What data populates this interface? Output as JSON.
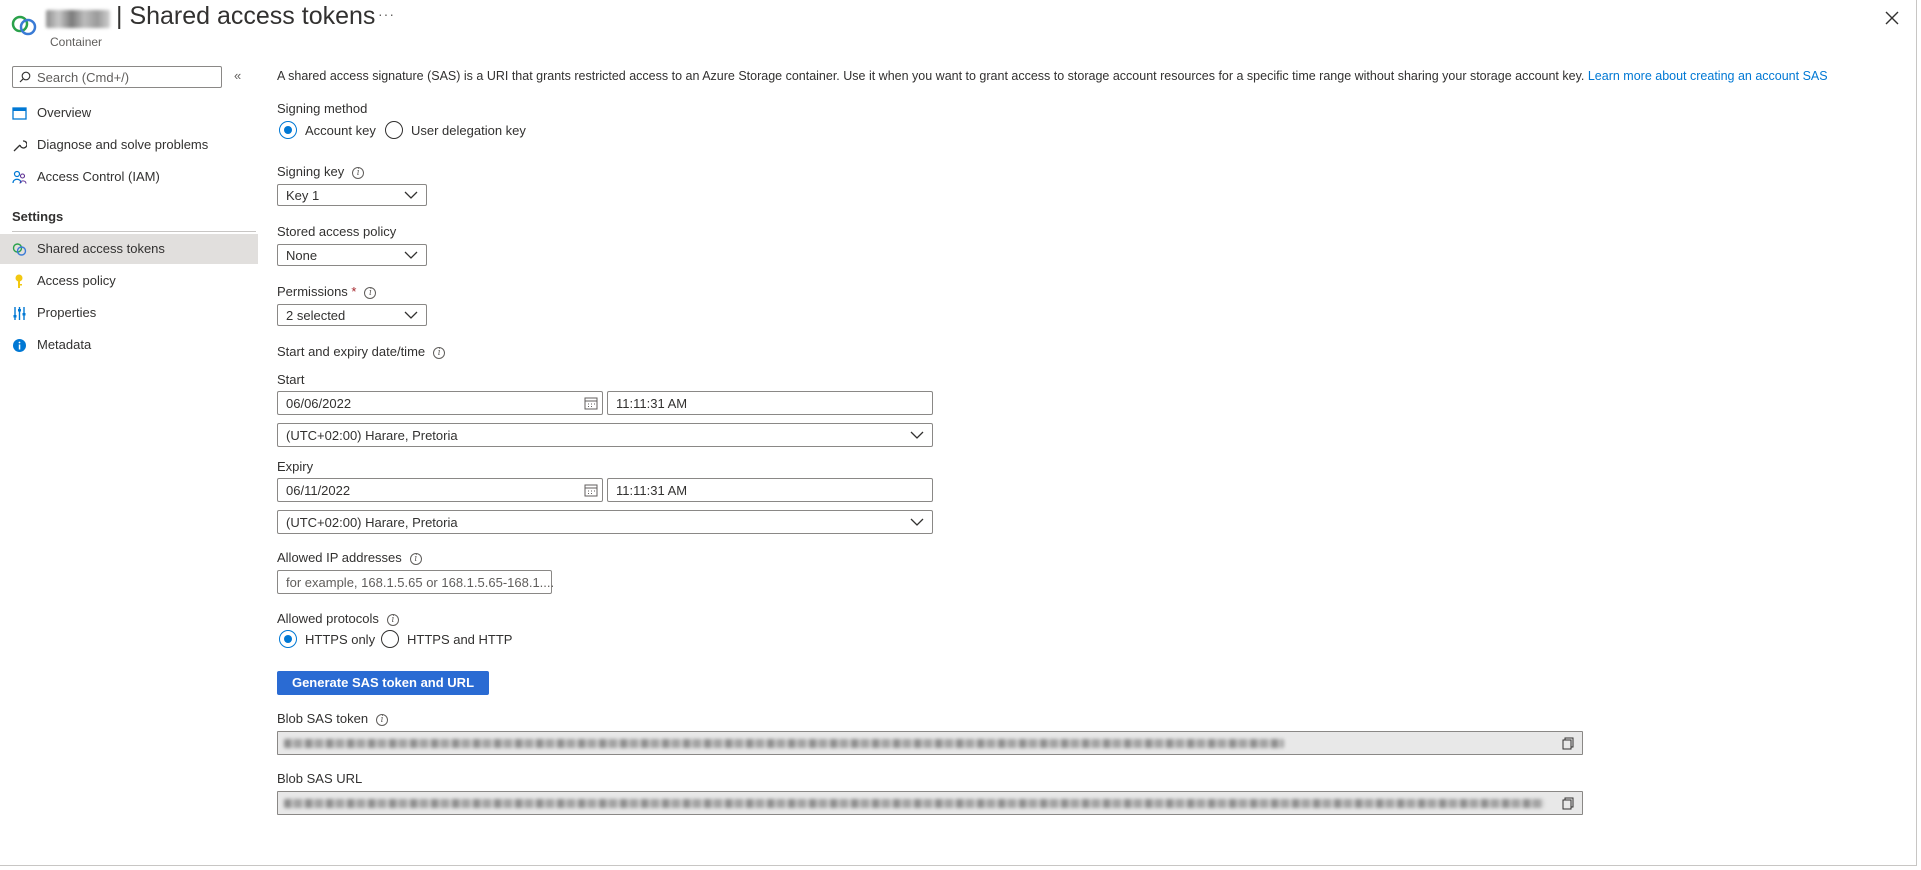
{
  "header": {
    "title": "| Shared access tokens",
    "subtitle": "Container",
    "more_label": "···",
    "close_icon": "close-icon"
  },
  "sidebar": {
    "search_placeholder": "Search (Cmd+/)",
    "collapse_label": "«",
    "items": [
      {
        "label": "Overview",
        "icon": "overview-icon"
      },
      {
        "label": "Diagnose and solve problems",
        "icon": "wrench-icon"
      },
      {
        "label": "Access Control (IAM)",
        "icon": "people-icon"
      }
    ],
    "settings_header": "Settings",
    "settings_items": [
      {
        "label": "Shared access tokens",
        "icon": "link-icon",
        "active": true
      },
      {
        "label": "Access policy",
        "icon": "key-icon"
      },
      {
        "label": "Properties",
        "icon": "sliders-icon"
      },
      {
        "label": "Metadata",
        "icon": "info-icon"
      }
    ]
  },
  "main": {
    "intro_text": "A shared access signature (SAS) is a URI that grants restricted access to an Azure Storage container. Use it when you want to grant access to storage account resources for a specific time range without sharing your storage account key.",
    "intro_link": "Learn more about creating an account SAS",
    "signing_method": {
      "label": "Signing method",
      "options": [
        "Account key",
        "User delegation key"
      ],
      "selected": "Account key"
    },
    "signing_key": {
      "label": "Signing key",
      "value": "Key 1"
    },
    "stored_access_policy": {
      "label": "Stored access policy",
      "value": "None"
    },
    "permissions": {
      "label": "Permissions",
      "required_mark": "*",
      "value": "2 selected"
    },
    "start_expiry": {
      "label": "Start and expiry date/time"
    },
    "start": {
      "label": "Start",
      "date": "06/06/2022",
      "time": "11:11:31 AM",
      "timezone": "(UTC+02:00) Harare, Pretoria"
    },
    "expiry": {
      "label": "Expiry",
      "date": "06/11/2022",
      "time": "11:11:31 AM",
      "timezone": "(UTC+02:00) Harare, Pretoria"
    },
    "allowed_ip": {
      "label": "Allowed IP addresses",
      "placeholder": "for example, 168.1.5.65 or 168.1.5.65-168.1...."
    },
    "allowed_protocols": {
      "label": "Allowed protocols",
      "options": [
        "HTTPS only",
        "HTTPS and HTTP"
      ],
      "selected": "HTTPS only"
    },
    "generate_button": "Generate SAS token and URL",
    "blob_sas_token": {
      "label": "Blob SAS token"
    },
    "blob_sas_url": {
      "label": "Blob SAS URL"
    }
  },
  "colors": {
    "accent": "#0078d4",
    "button": "#2a6bd3",
    "active_nav": "#e1dfdd"
  }
}
